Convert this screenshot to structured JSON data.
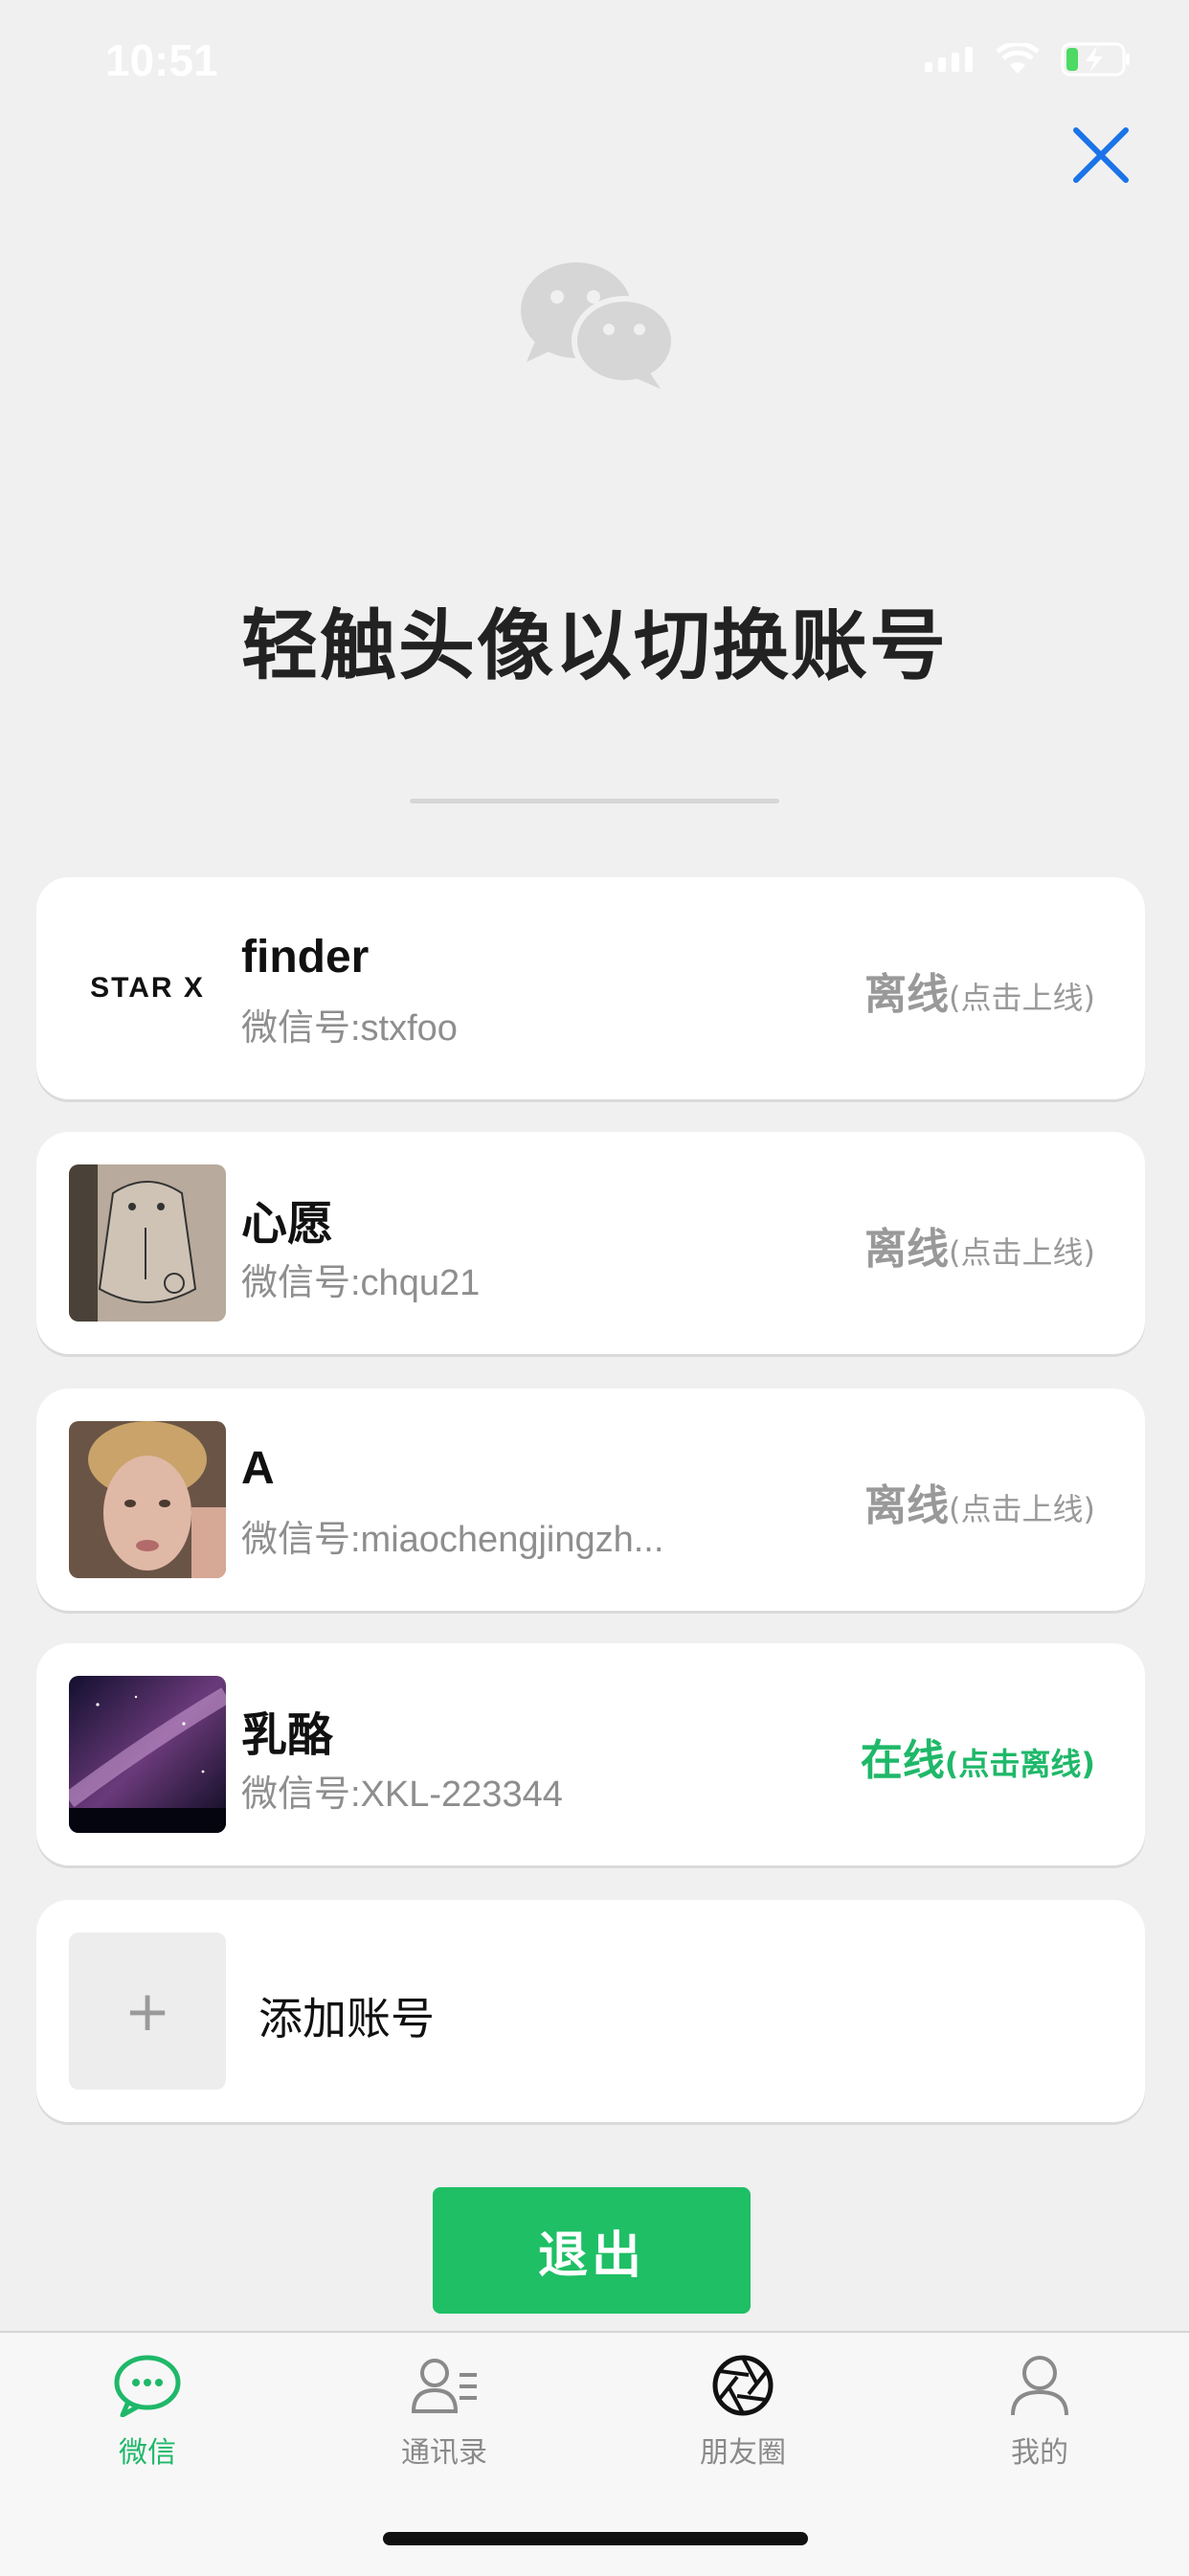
{
  "status_bar": {
    "time": "10:51"
  },
  "title": "轻触头像以切换账号",
  "accounts": [
    {
      "logo_text": "STAR X",
      "name": "finder",
      "wechat_id": "微信号:stxfoo",
      "status": "离线",
      "hint": "(点击上线)"
    },
    {
      "name": "心愿",
      "wechat_id": "微信号:chqu21",
      "status": "离线",
      "hint": "(点击上线)"
    },
    {
      "name": "A",
      "wechat_id": "微信号:miaochengjingzh...",
      "status": "离线",
      "hint": "(点击上线)"
    },
    {
      "name": "乳酪",
      "wechat_id": "微信号:XKL-223344",
      "status": "在线",
      "hint": "(点击离线)"
    }
  ],
  "add_account": {
    "plus": "+",
    "label": "添加账号"
  },
  "exit_button": "退出",
  "tabs": [
    {
      "label": "微信",
      "icon": "chat-bubble-icon"
    },
    {
      "label": "通讯录",
      "icon": "contacts-icon"
    },
    {
      "label": "朋友圈",
      "icon": "aperture-icon"
    },
    {
      "label": "我的",
      "icon": "person-icon"
    }
  ],
  "colors": {
    "accent": "#1fb869",
    "button": "#1fbf65",
    "close": "#1a73e8"
  }
}
